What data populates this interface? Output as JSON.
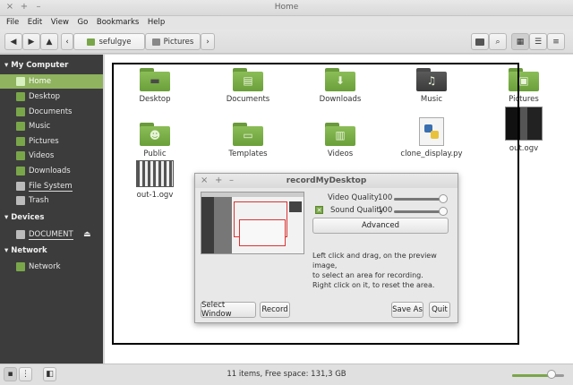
{
  "window": {
    "title": "Home",
    "close": "×",
    "add": "+",
    "minimize": "–"
  },
  "menu": [
    "File",
    "Edit",
    "View",
    "Go",
    "Bookmarks",
    "Help"
  ],
  "toolbar": {
    "crumbs": [
      "sefulgye",
      "Pictures"
    ]
  },
  "sidebar": {
    "my_computer": "My Computer",
    "computer_items": [
      "Home",
      "Desktop",
      "Documents",
      "Music",
      "Pictures",
      "Videos",
      "Downloads",
      "File System",
      "Trash"
    ],
    "devices": "Devices",
    "device_items": [
      "DOCUMENT"
    ],
    "network": "Network",
    "network_items": [
      "Network"
    ]
  },
  "files": [
    "Desktop",
    "Documents",
    "Downloads",
    "Music",
    "Pictures",
    "Public",
    "Templates",
    "Videos",
    "clone_display.py",
    "out.ogv",
    "out-1.ogv"
  ],
  "dialog": {
    "title": "recordMyDesktop",
    "video_quality_label": "Video Quality",
    "video_quality_value": "100",
    "sound_quality_label": "Sound Quality",
    "sound_quality_value": "100",
    "advanced": "Advanced",
    "help_line1": "Left click and drag, on the preview image,",
    "help_line2": "to select an area for recording.",
    "help_line3": "Right click on it, to reset the area.",
    "select_window": "Select Window",
    "record": "Record",
    "save_as": "Save As",
    "quit": "Quit"
  },
  "status": {
    "text": "11 items, Free space: 131,3 GB",
    "zoom_fraction": 0.75
  }
}
